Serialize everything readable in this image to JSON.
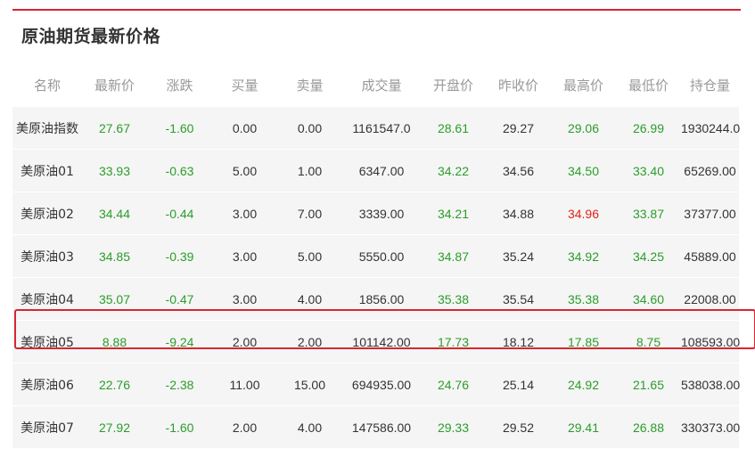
{
  "title": "原油期货最新价格",
  "columns": [
    "名称",
    "最新价",
    "涨跌",
    "买量",
    "卖量",
    "成交量",
    "开盘价",
    "昨收价",
    "最高价",
    "最低价",
    "持仓量"
  ],
  "rows": [
    {
      "name": "美原油指数",
      "cells": [
        "27.67",
        "-1.60",
        "0.00",
        "0.00",
        "1161547.0",
        "28.61",
        "29.27",
        "29.06",
        "26.99",
        "1930244.0"
      ],
      "colors": [
        "down",
        "down",
        "flat",
        "flat",
        "flat",
        "down",
        "flat",
        "down",
        "down",
        "flat"
      ]
    },
    {
      "name": "美原油01",
      "cells": [
        "33.93",
        "-0.63",
        "5.00",
        "1.00",
        "6347.00",
        "34.22",
        "34.56",
        "34.50",
        "33.40",
        "65269.00"
      ],
      "colors": [
        "down",
        "down",
        "flat",
        "flat",
        "flat",
        "down",
        "flat",
        "down",
        "down",
        "flat"
      ]
    },
    {
      "name": "美原油02",
      "cells": [
        "34.44",
        "-0.44",
        "3.00",
        "7.00",
        "3339.00",
        "34.21",
        "34.88",
        "34.96",
        "33.87",
        "37377.00"
      ],
      "colors": [
        "down",
        "down",
        "flat",
        "flat",
        "flat",
        "down",
        "flat",
        "up",
        "down",
        "flat"
      ]
    },
    {
      "name": "美原油03",
      "cells": [
        "34.85",
        "-0.39",
        "3.00",
        "5.00",
        "5550.00",
        "34.87",
        "35.24",
        "34.92",
        "34.25",
        "45889.00"
      ],
      "colors": [
        "down",
        "down",
        "flat",
        "flat",
        "flat",
        "down",
        "flat",
        "down",
        "down",
        "flat"
      ]
    },
    {
      "name": "美原油04",
      "cells": [
        "35.07",
        "-0.47",
        "3.00",
        "4.00",
        "1856.00",
        "35.38",
        "35.54",
        "35.38",
        "34.60",
        "22008.00"
      ],
      "colors": [
        "down",
        "down",
        "flat",
        "flat",
        "flat",
        "down",
        "flat",
        "down",
        "down",
        "flat"
      ]
    },
    {
      "name": "美原油05",
      "cells": [
        "8.88",
        "-9.24",
        "2.00",
        "2.00",
        "101142.00",
        "17.73",
        "18.12",
        "17.85",
        "8.75",
        "108593.00"
      ],
      "colors": [
        "down",
        "down",
        "flat",
        "flat",
        "flat",
        "down",
        "flat",
        "down",
        "down",
        "flat"
      ]
    },
    {
      "name": "美原油06",
      "cells": [
        "22.76",
        "-2.38",
        "11.00",
        "15.00",
        "694935.00",
        "24.76",
        "25.14",
        "24.92",
        "21.65",
        "538038.00"
      ],
      "colors": [
        "down",
        "down",
        "flat",
        "flat",
        "flat",
        "down",
        "flat",
        "down",
        "down",
        "flat"
      ]
    },
    {
      "name": "美原油07",
      "cells": [
        "27.92",
        "-1.60",
        "2.00",
        "4.00",
        "147586.00",
        "29.33",
        "29.52",
        "29.41",
        "26.88",
        "330373.00"
      ],
      "colors": [
        "down",
        "down",
        "flat",
        "flat",
        "flat",
        "down",
        "flat",
        "down",
        "down",
        "flat"
      ]
    }
  ],
  "colors": {
    "accent": "#d8262e",
    "up": "#e2231a",
    "down": "#2a9d2a",
    "header_text": "#999999",
    "row_bg": "#f5f5f5"
  }
}
